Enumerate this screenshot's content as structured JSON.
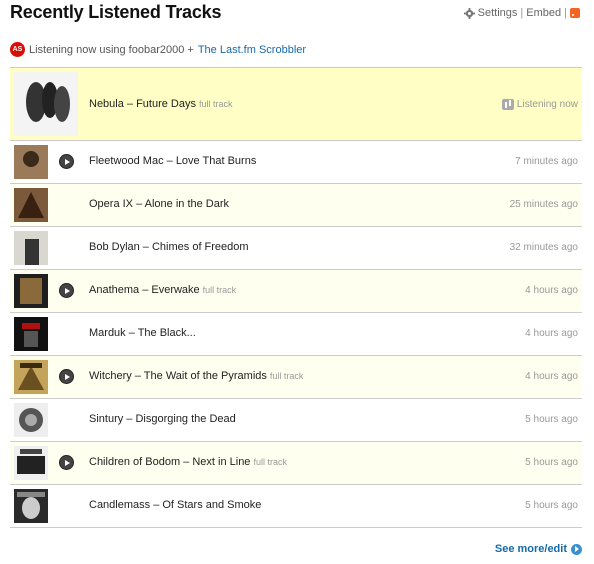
{
  "header": {
    "title": "Recently Listened Tracks",
    "settings_label": "Settings",
    "embed_label": "Embed",
    "separator": "|"
  },
  "now_playing": {
    "logo_text": "AS",
    "text": "Listening now using foobar2000 +",
    "link_label": "The Last.fm Scrobbler"
  },
  "tracks": [
    {
      "title": "Nebula – Future Days",
      "full_track": "full track",
      "time": "Listening now",
      "current": true,
      "art_color": "#e8e8e8"
    },
    {
      "title": "Fleetwood Mac – Love That Burns",
      "full_track": "",
      "time": "7 minutes ago",
      "play": true,
      "art_color": "#8a6a50"
    },
    {
      "title": "Opera IX – Alone in the Dark",
      "full_track": "",
      "time": "25 minutes ago",
      "art_color": "#6a4a2a"
    },
    {
      "title": "Bob Dylan – Chimes of Freedom",
      "full_track": "",
      "time": "32 minutes ago",
      "art_color": "#c8c8c0"
    },
    {
      "title": "Anathema – Everwake",
      "full_track": "full track",
      "time": "4 hours ago",
      "play": true,
      "art_color": "#7a5a30"
    },
    {
      "title": "Marduk – The Black...",
      "full_track": "",
      "time": "4 hours ago",
      "art_color": "#1a1a1a"
    },
    {
      "title": "Witchery – The Wait of the Pyramids",
      "full_track": "full track",
      "time": "4 hours ago",
      "play": true,
      "art_color": "#b0924a"
    },
    {
      "title": "Sintury – Disgorging the Dead",
      "full_track": "",
      "time": "5 hours ago",
      "art_color": "#5a5a5a"
    },
    {
      "title": "Children of Bodom – Next in Line",
      "full_track": "full track",
      "time": "5 hours ago",
      "play": true,
      "art_color": "#2a2a2a"
    },
    {
      "title": "Candlemass – Of Stars and Smoke",
      "full_track": "",
      "time": "5 hours ago",
      "art_color": "#3a3a3a"
    }
  ],
  "footer": {
    "more_label": "See more/edit"
  }
}
